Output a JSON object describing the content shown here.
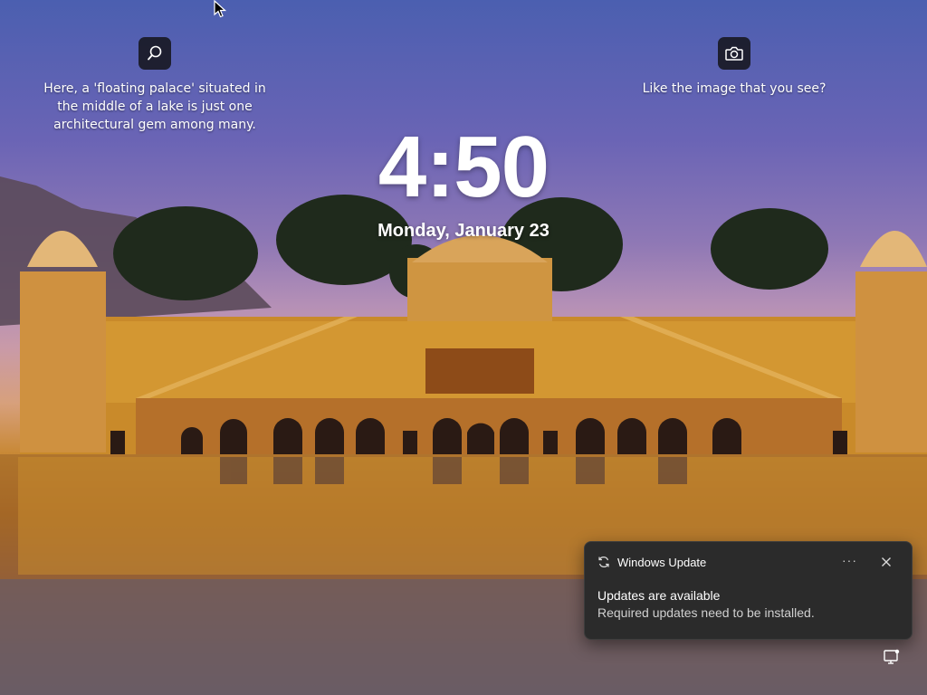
{
  "lockscreen": {
    "time": "4:50",
    "date": "Monday, January 23",
    "left_caption": "Here, a 'floating palace' situated in the middle of a lake is just one architectural gem among many.",
    "right_caption": "Like the image that you see?"
  },
  "notification": {
    "app_name": "Windows Update",
    "more_label": "···",
    "title": "Updates are available",
    "body": "Required updates need to be installed."
  },
  "icons": {
    "left_button": "search-icon",
    "right_button": "camera-icon",
    "notification_app": "refresh-icon",
    "tray": "network-status-icon"
  },
  "colors": {
    "toast_bg": "#2b2b2b",
    "icon_button_bg": "#141419"
  }
}
